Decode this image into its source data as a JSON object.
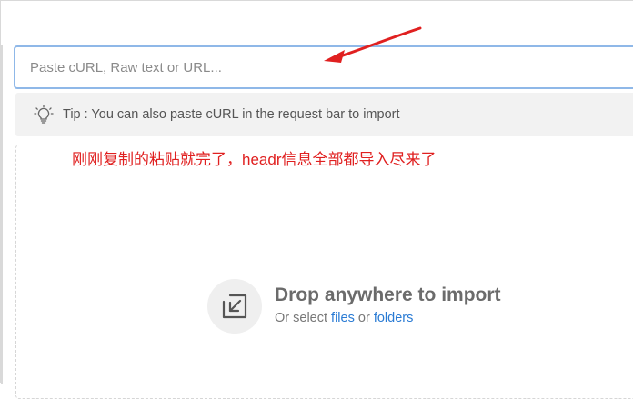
{
  "import_dialog": {
    "input": {
      "placeholder": "Paste cURL, Raw text or URL...",
      "value": ""
    },
    "tip": {
      "text": "Tip : You can also paste cURL in the request bar to import"
    },
    "annotation": {
      "text": "刚刚复制的粘贴就完了，headr信息全部都导入尽来了"
    },
    "drop": {
      "title": "Drop anywhere to import",
      "sub_prefix": "Or select",
      "files_link": "files",
      "sub_or": "or",
      "folders_link": "folders"
    }
  },
  "icons": {
    "tip": "lightbulb-icon",
    "drop": "import-tray-icon",
    "annotation_arrow": "red-arrow"
  },
  "colors": {
    "input_focus_border": "#8fb8e8",
    "link": "#2a7bd4",
    "annotation": "#e02020",
    "tip_background": "#f2f2f2"
  }
}
